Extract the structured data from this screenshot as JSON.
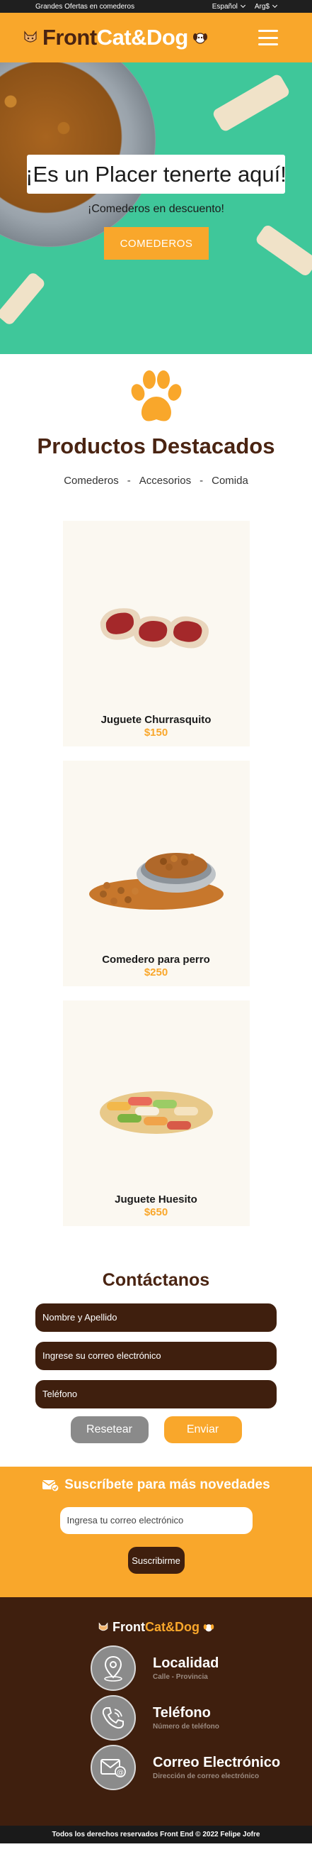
{
  "topbar": {
    "promo": "Grandes Ofertas en comederos",
    "language": "Español",
    "currency": "Arg$"
  },
  "header": {
    "brand_front": "Front",
    "brand_catdog": "Cat&Dog"
  },
  "hero": {
    "title": "¡Es un Placer tenerte aquí!",
    "subtitle": "¡Comederos en descuento!",
    "cta": "COMEDEROS"
  },
  "featured": {
    "title": "Productos Destacados",
    "filters": [
      "Comederos",
      "Accesorios",
      "Comida"
    ],
    "separator": "-"
  },
  "products": [
    {
      "name": "Juguete Churrasquito",
      "price": "$150"
    },
    {
      "name": "Comedero para perro",
      "price": "$250"
    },
    {
      "name": "Juguete Huesito",
      "price": "$650"
    }
  ],
  "contact": {
    "title": "Contáctanos",
    "name_placeholder": "Nombre y Apellido",
    "email_placeholder": "Ingrese su correo electrónico",
    "phone_placeholder": "Teléfono",
    "reset": "Resetear",
    "send": "Enviar"
  },
  "newsletter": {
    "title": "Suscríbete para más novedades",
    "email_placeholder": "Ingresa tu correo electrónico",
    "button": "Suscribirme"
  },
  "footer": {
    "brand_front": "Front",
    "brand_catdog": "Cat&Dog",
    "items": [
      {
        "title": "Localidad",
        "subtitle": "Calle - Provincia",
        "icon": "location-icon"
      },
      {
        "title": "Teléfono",
        "subtitle": "Número de teléfono",
        "icon": "phone-icon"
      },
      {
        "title": "Correo Electrónico",
        "subtitle": "Dirección de correo electrónico",
        "icon": "email-icon"
      }
    ],
    "copyright": "Todos los derechos reservados Front End © 2022 Felipe Jofre"
  },
  "colors": {
    "accent": "#f9a72b",
    "brown": "#4a2412",
    "dark_brown": "#3f1f0e",
    "hero_green": "#3fc79a"
  }
}
